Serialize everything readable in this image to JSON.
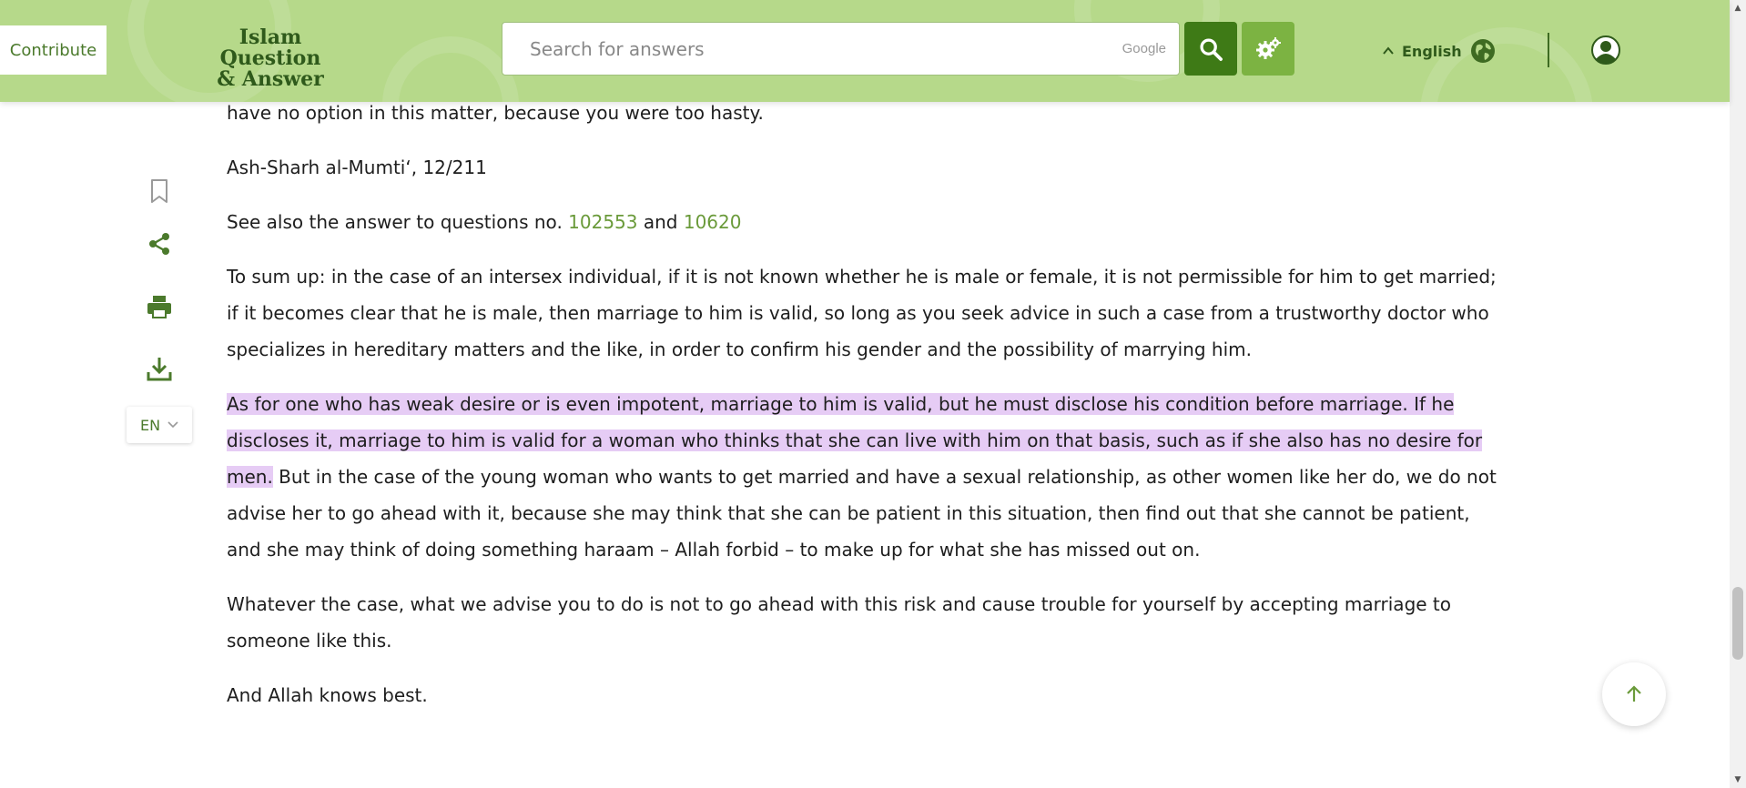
{
  "header": {
    "contribute_label": "Contribute",
    "logo_line1": "Islam Question",
    "logo_line2": "& Answer",
    "search_placeholder": "Search for answers",
    "search_provider": "Google",
    "language_label": "English",
    "colors": {
      "header_bg": "#b6d98a",
      "brand_dark": "#2f5a1b",
      "search_btn": "#3e7a16",
      "settings_btn": "#7cb342"
    }
  },
  "toolbar": {
    "icons": [
      "bookmark-icon",
      "share-icon",
      "print-icon",
      "download-icon"
    ],
    "lang_code": "EN"
  },
  "article": {
    "p1": "have no option in this matter, because you were too hasty.",
    "p2": "Ash-Sharh al-Mumti‘, 12/211",
    "p3_prefix": "See also the answer to questions no. ",
    "p3_link1": "102553",
    "p3_mid": " and ",
    "p3_link2": "10620",
    "p4": "To sum up: in the case of an intersex individual, if it is not known whether he is male or female, it is not permissible for him to get married; if it becomes clear that he is male, then marriage to him is valid, so long as you seek advice in such a case from a trustworthy doctor who specializes in hereditary matters and the like, in order to confirm his gender and the possibility of marrying him.",
    "p5_highlight": "As for one who has weak desire or is even impotent, marriage to him is valid, but he must disclose his condition before marriage. If he discloses it, marriage to him is valid for a woman who thinks that she can live with him on that basis, such as if she also has no desire for men.",
    "p5_rest": " But in the case of the young woman who wants to get married and have a sexual relationship, as other women like her do, we do not advise her to go ahead with it, because she may think that she can be patient in this situation, then find out that she cannot be patient, and she may think of doing something haraam – Allah forbid – to make up for what she has missed out on.",
    "p6": "Whatever the case, what we advise you to do is not to go ahead with this risk and cause trouble for yourself by accepting marriage to someone like this.",
    "p7": "And Allah knows best.",
    "highlight_color": "#e6ccf5",
    "link_color": "#6a9a3a"
  }
}
